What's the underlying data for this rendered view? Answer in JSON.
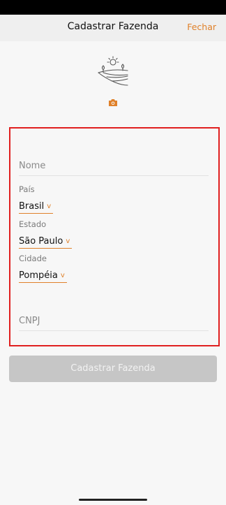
{
  "header": {
    "title": "Cadastrar Fazenda",
    "close_label": "Fechar"
  },
  "form": {
    "nome": {
      "placeholder": "Nome"
    },
    "pais": {
      "label": "País",
      "value": "Brasil",
      "icon": "chevron-down-icon"
    },
    "estado": {
      "label": "Estado",
      "value": "São Paulo",
      "icon": "chevron-down-icon"
    },
    "cidade": {
      "label": "Cidade",
      "value": "Pompéia",
      "icon": "chevron-down-icon"
    },
    "cnpj": {
      "placeholder": "CNPJ"
    }
  },
  "submit_label": "Cadastrar Fazenda",
  "colors": {
    "accent": "#e0812a",
    "frame": "#e01f1f",
    "button_disabled": "#c6c6c6"
  },
  "icons": {
    "logo": "farm-landscape-icon",
    "camera": "camera-icon"
  }
}
